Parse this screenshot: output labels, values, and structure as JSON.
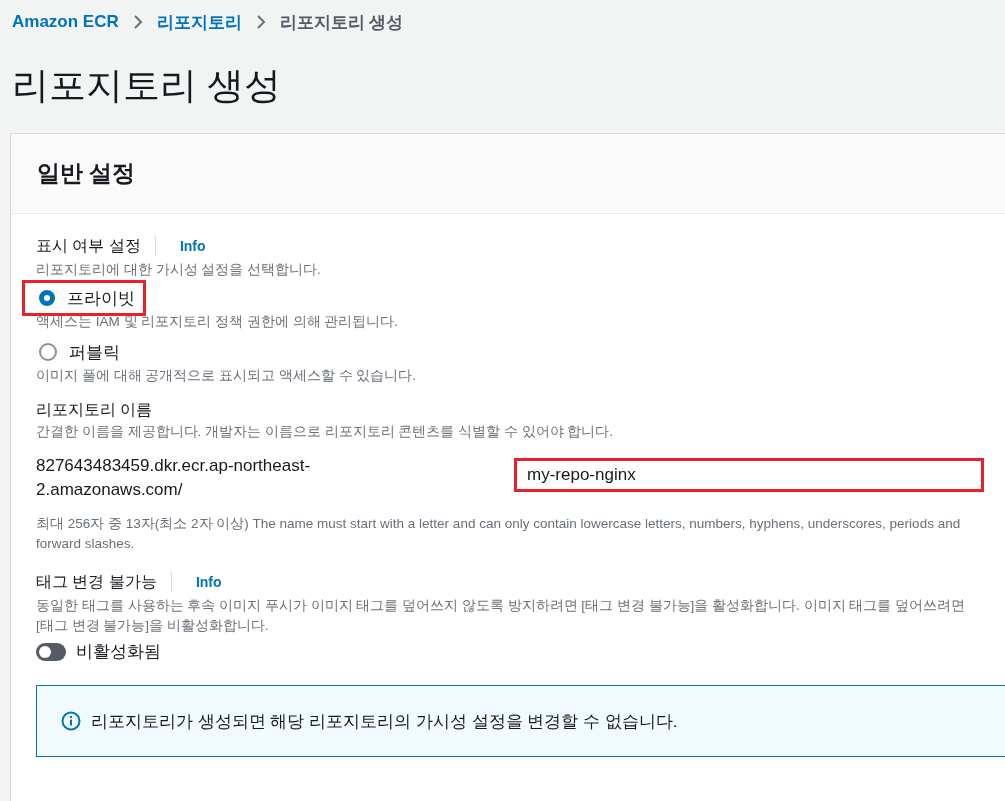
{
  "breadcrumb": [
    {
      "label": "Amazon ECR",
      "link": true
    },
    {
      "label": "리포지토리",
      "link": true
    },
    {
      "label": "리포지토리 생성",
      "link": false
    }
  ],
  "page_title": "리포지토리 생성",
  "panel": {
    "title": "일반 설정",
    "visibility": {
      "label": "표시 여부 설정",
      "info": "Info",
      "description": "리포지토리에 대한 가시성 설정을 선택합니다.",
      "options": [
        {
          "label": "프라이빗",
          "description": "액세스는 IAM 및 리포지토리 정책 권한에 의해 관리됩니다.",
          "selected": true,
          "highlighted": true
        },
        {
          "label": "퍼블릭",
          "description": "이미지 풀에 대해 공개적으로 표시되고 액세스할 수 있습니다.",
          "selected": false,
          "highlighted": false
        }
      ]
    },
    "repository_name": {
      "label": "리포지토리 이름",
      "description": "간결한 이름을 제공합니다. 개발자는 이름으로 리포지토리 콘텐츠를 식별할 수 있어야 합니다.",
      "prefix": "827643483459.dkr.ecr.ap-northeast-2.amazonaws.com/",
      "value": "my-repo-nginx",
      "highlighted": true,
      "constraint": "최대 256자 중 13자(최소 2자 이상) The name must start with a letter and can only contain lowercase letters, numbers, hyphens, underscores, periods and forward slashes."
    },
    "tag_immutability": {
      "label": "태그 변경 불가능",
      "info": "Info",
      "description": "동일한 태그를 사용하는 후속 이미지 푸시가 이미지 태그를 덮어쓰지 않도록 방지하려면 [태그 변경 불가능]을 활성화합니다. 이미지 태그를 덮어쓰려면 [태그 변경 불가능]을 비활성화합니다.",
      "on": false,
      "state_label": "비활성화됨"
    },
    "alert": {
      "text": "리포지토리가 생성되면 해당 리포지토리의 가시성 설정을 변경할 수 없습니다."
    }
  }
}
